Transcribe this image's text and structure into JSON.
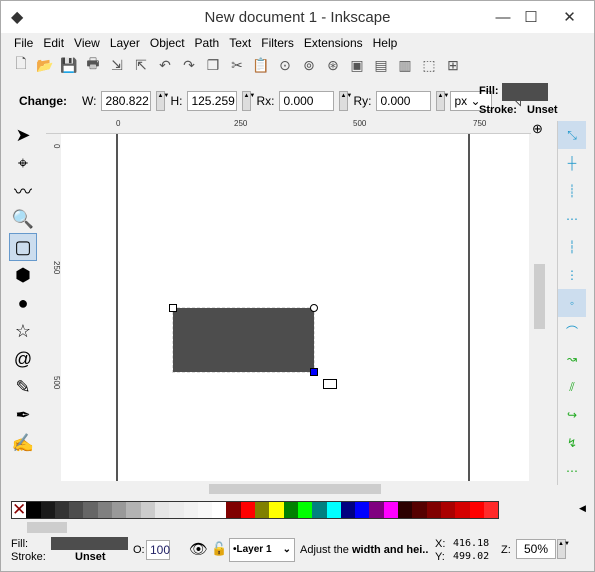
{
  "window": {
    "title": "New document 1 - Inkscape",
    "controls": [
      "—",
      "☐",
      "✕"
    ]
  },
  "menu": [
    "File",
    "Edit",
    "View",
    "Layer",
    "Object",
    "Path",
    "Text",
    "Filters",
    "Extensions",
    "Help"
  ],
  "toolbar_icons": [
    "new-icon",
    "open-icon",
    "save-icon",
    "print-icon",
    "import-icon",
    "export-icon",
    "undo-icon",
    "redo-icon",
    "duplicate-icon",
    "cut-icon",
    "paste-icon",
    "zoom-selection-icon",
    "zoom-drawing-icon",
    "zoom-page-icon",
    "group-icon",
    "ungroup-icon",
    "clone-icon",
    "fill-stroke-icon",
    "align-icon"
  ],
  "controls": {
    "change_label": "Change:",
    "w_label": "W:",
    "w": "280.822",
    "h_label": "H:",
    "h": "125.259",
    "rx_label": "Rx:",
    "rx": "0.000",
    "ry_label": "Ry:",
    "ry": "0.000",
    "unit": "px",
    "fill_label": "Fill:",
    "stroke_label": "Stroke:",
    "stroke": "Unset",
    "fill_color": "#4d4d4d"
  },
  "ruler": {
    "h_ticks": [
      "0",
      "250",
      "500",
      "750"
    ],
    "v_ticks": [
      "0",
      "250",
      "500"
    ]
  },
  "palette": [
    "#000000",
    "#1a1a1a",
    "#333333",
    "#4d4d4d",
    "#666666",
    "#808080",
    "#999999",
    "#b3b3b3",
    "#cccccc",
    "#e6e6e6",
    "#ececec",
    "#f2f2f2",
    "#f8f8f8",
    "#ffffff",
    "#800000",
    "#ff0000",
    "#808000",
    "#ffff00",
    "#008000",
    "#00ff00",
    "#008080",
    "#00ffff",
    "#000080",
    "#0000ff",
    "#800080",
    "#ff00ff",
    "#2b0000",
    "#550000",
    "#800000",
    "#aa0000",
    "#d40000",
    "#ff0000",
    "#ff2a2a"
  ],
  "status": {
    "fill_label": "Fill:",
    "stroke_label": "Stroke:",
    "stroke": "Unset",
    "opacity_label": "O:",
    "opacity": "100",
    "layer": "•Layer 1",
    "message_plain": "Adjust the ",
    "message_bold": "width and hei..",
    "x_label": "X:",
    "x": "416.18",
    "y_label": "Y:",
    "y": "499.02",
    "zoom_label": "Z:",
    "zoom": "50%"
  }
}
